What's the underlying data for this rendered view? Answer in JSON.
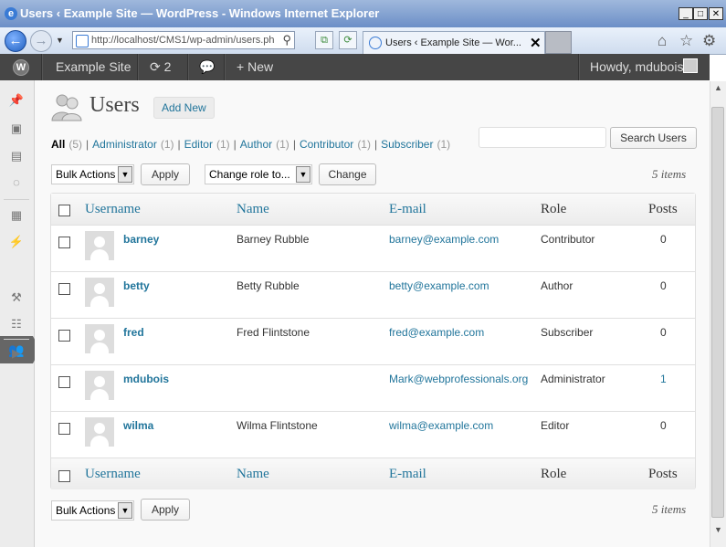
{
  "window": {
    "title": "Users ‹ Example Site — WordPress - Windows Internet Explorer",
    "controls": {
      "minimize": "_",
      "maximize": "□",
      "close": "✕"
    }
  },
  "browser": {
    "address": "http://localhost/CMS1/wp-admin/users.ph",
    "tab_title": "Users ‹ Example Site — Wor...",
    "tab_close": "✕"
  },
  "adminbar": {
    "logo": "W",
    "site_name": "Example Site",
    "updates_count": "2",
    "new_label": "New",
    "greeting": "Howdy, mdubois"
  },
  "page": {
    "title": "Users",
    "add_new": "Add New",
    "filters": [
      {
        "label": "All",
        "count": "(5)",
        "current": true
      },
      {
        "label": "Administrator",
        "count": "(1)"
      },
      {
        "label": "Editor",
        "count": "(1)"
      },
      {
        "label": "Author",
        "count": "(1)"
      },
      {
        "label": "Contributor",
        "count": "(1)"
      },
      {
        "label": "Subscriber",
        "count": "(1)"
      }
    ],
    "search_button": "Search Users",
    "search_value": "",
    "bulk_actions": "Bulk Actions",
    "apply": "Apply",
    "change_role": "Change role to...",
    "change": "Change",
    "items_count": "5 items"
  },
  "table": {
    "columns": [
      "Username",
      "Name",
      "E-mail",
      "Role",
      "Posts"
    ],
    "rows": [
      {
        "username": "barney",
        "name": "Barney Rubble",
        "email": "barney@example.com",
        "role": "Contributor",
        "posts": "0"
      },
      {
        "username": "betty",
        "name": "Betty Rubble",
        "email": "betty@example.com",
        "role": "Author",
        "posts": "0"
      },
      {
        "username": "fred",
        "name": "Fred Flintstone",
        "email": "fred@example.com",
        "role": "Subscriber",
        "posts": "0"
      },
      {
        "username": "mdubois",
        "name": "",
        "email": "Mark@webprofessionals.org",
        "role": "Administrator",
        "posts": "1"
      },
      {
        "username": "wilma",
        "name": "Wilma Flintstone",
        "email": "wilma@example.com",
        "role": "Editor",
        "posts": "0"
      }
    ]
  },
  "colors": {
    "wp_link": "#21759b",
    "adminbar_bg": "#464646",
    "content_bg": "#f9f9f9"
  },
  "icons": [
    "ie-logo-icon",
    "back-arrow-icon",
    "forward-arrow-icon",
    "search-icon",
    "home-icon",
    "favorites-star-icon",
    "gear-icon",
    "wordpress-logo-icon",
    "updates-icon",
    "comments-icon",
    "plus-icon",
    "users-icon",
    "pin-icon",
    "media-icon",
    "pages-icon",
    "comment-icon",
    "appearance-icon",
    "plugins-icon",
    "users-menu-icon",
    "tools-icon",
    "settings-icon",
    "collapse-icon"
  ]
}
